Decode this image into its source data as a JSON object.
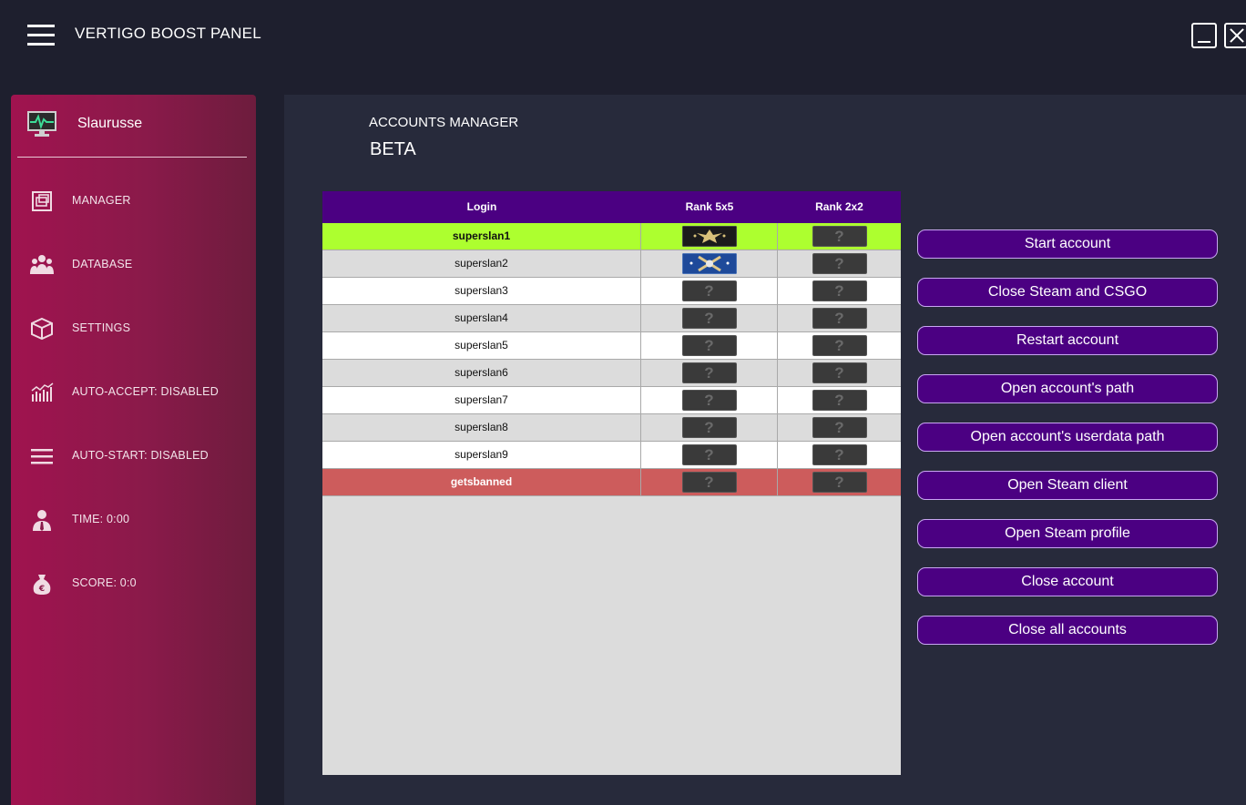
{
  "app": {
    "title": "VERTIGO BOOST PANEL"
  },
  "profile": {
    "name": "Slaurusse"
  },
  "sidebar": {
    "items": [
      {
        "label": "MANAGER",
        "icon": "windows-icon"
      },
      {
        "label": "DATABASE",
        "icon": "group-icon"
      },
      {
        "label": "SETTINGS",
        "icon": "box-icon"
      },
      {
        "label": "AUTO-ACCEPT: DISABLED",
        "icon": "chart-icon"
      },
      {
        "label": "AUTO-START: DISABLED",
        "icon": "list-icon"
      },
      {
        "label": "TIME: 0:00",
        "icon": "user-icon"
      },
      {
        "label": "SCORE: 0:0",
        "icon": "money-bag-icon"
      }
    ]
  },
  "main": {
    "title": "ACCOUNTS MANAGER",
    "subtitle": "BETA"
  },
  "table": {
    "headers": [
      "Login",
      "Rank 5x5",
      "Rank 2x2"
    ],
    "rows": [
      {
        "login": "superslan1",
        "rank5x5": "eagle-rank",
        "rank2x2": "unknown",
        "style": "selected"
      },
      {
        "login": "superslan2",
        "rank5x5": "crossed-rifles-rank",
        "rank2x2": "unknown",
        "style": "alt"
      },
      {
        "login": "superslan3",
        "rank5x5": "unknown",
        "rank2x2": "unknown",
        "style": "normal"
      },
      {
        "login": "superslan4",
        "rank5x5": "unknown",
        "rank2x2": "unknown",
        "style": "alt"
      },
      {
        "login": "superslan5",
        "rank5x5": "unknown",
        "rank2x2": "unknown",
        "style": "normal"
      },
      {
        "login": "superslan6",
        "rank5x5": "unknown",
        "rank2x2": "unknown",
        "style": "alt"
      },
      {
        "login": "superslan7",
        "rank5x5": "unknown",
        "rank2x2": "unknown",
        "style": "normal"
      },
      {
        "login": "superslan8",
        "rank5x5": "unknown",
        "rank2x2": "unknown",
        "style": "alt"
      },
      {
        "login": "superslan9",
        "rank5x5": "unknown",
        "rank2x2": "unknown",
        "style": "normal"
      },
      {
        "login": "getsbanned",
        "rank5x5": "unknown",
        "rank2x2": "unknown",
        "style": "banned"
      }
    ]
  },
  "actions": [
    "Start account",
    "Close Steam and CSGO",
    "Restart account",
    "Open account's path",
    "Open account's userdata path",
    "Open Steam client",
    "Open Steam profile",
    "Close account",
    "Close all accounts"
  ],
  "colors": {
    "accent": "#4b0082",
    "selected_row": "#adff2f",
    "banned_row": "#cd5c5c",
    "alt_row": "#dcdcdc",
    "normal_row": "#ffffff"
  }
}
